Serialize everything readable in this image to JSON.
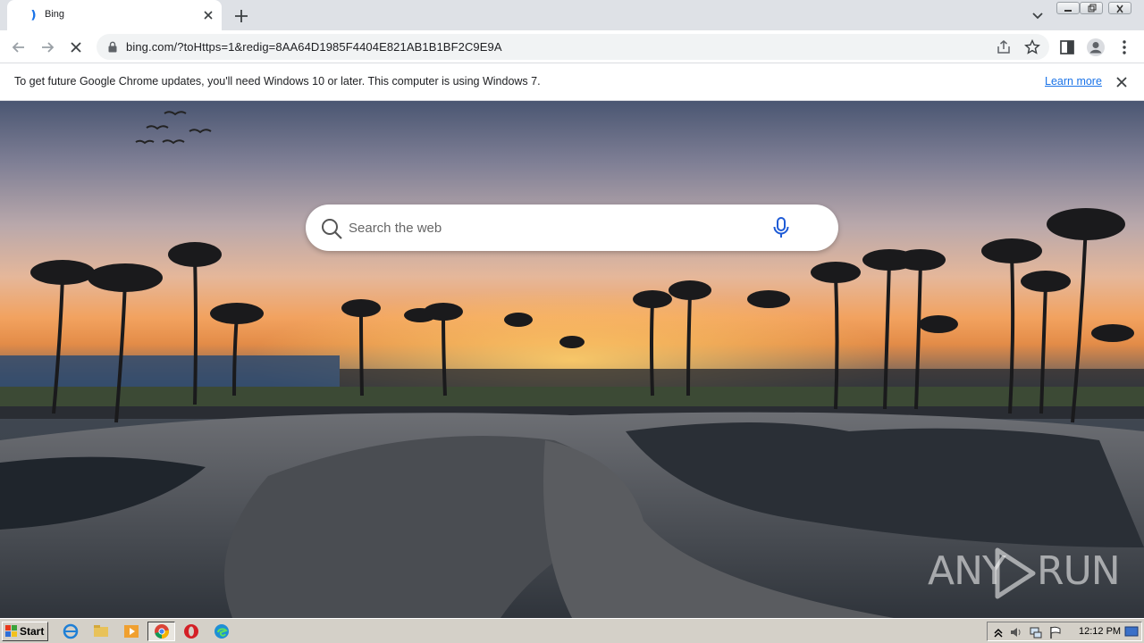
{
  "browser": {
    "tab": {
      "title": "Bing"
    },
    "address": {
      "url": "bing.com/?toHttps=1&redig=8AA64D1985F4404E821AB1B1BF2C9E9A"
    },
    "infobar": {
      "message": "To get future Google Chrome updates, you'll need Windows 10 or later. This computer is using Windows 7.",
      "link": "Learn more"
    }
  },
  "page": {
    "search": {
      "placeholder": "Search the web"
    },
    "watermark": {
      "left": "ANY",
      "right": "RUN"
    }
  },
  "taskbar": {
    "start_label": "Start",
    "clock": "12:12 PM"
  },
  "icons": {
    "tab_favicon": "bing-icon",
    "search": "search-icon",
    "mic": "microphone-icon"
  },
  "colors": {
    "accent": "#1a73e8",
    "mic": "#1e5bd6",
    "tabstrip": "#dee1e6",
    "taskbar": "#d4d0c8"
  }
}
